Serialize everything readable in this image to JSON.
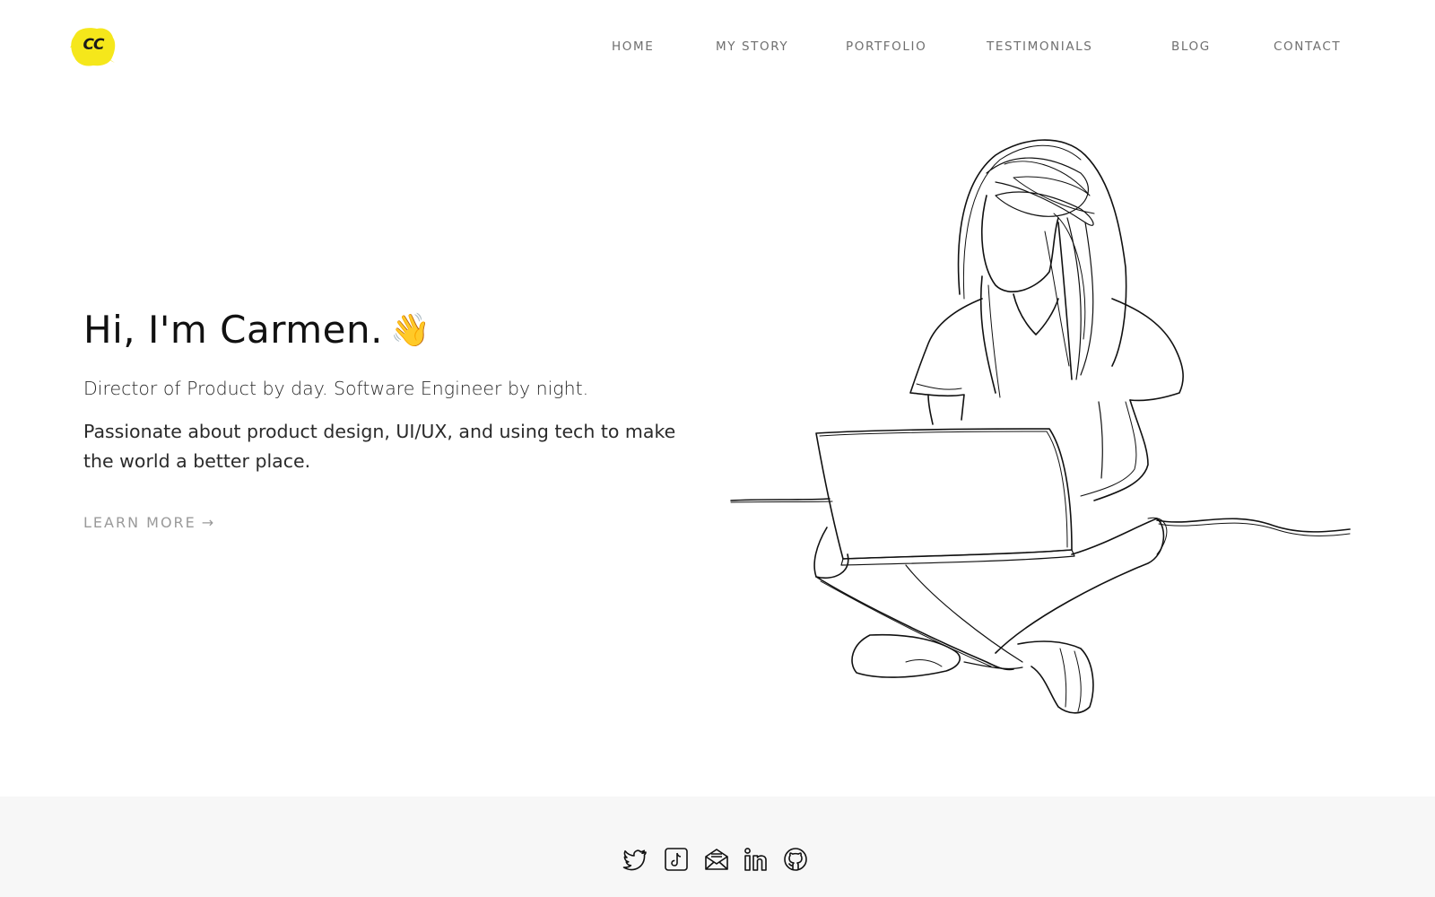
{
  "logo": {
    "text": "CC",
    "color": "#f5e71b"
  },
  "nav": {
    "items": [
      {
        "label": "HOME"
      },
      {
        "label": "MY STORY"
      },
      {
        "label": "PORTFOLIO"
      },
      {
        "label": "TESTIMONIALS"
      },
      {
        "label": "BLOG"
      },
      {
        "label": "CONTACT"
      }
    ]
  },
  "hero": {
    "title": "Hi, I'm Carmen.",
    "title_emoji": "👋",
    "subtitle": "Director of Product by day. Software Engineer by night.",
    "description": "Passionate about product design, UI/UX, and using tech to make the world a better place.",
    "cta_label": "LEARN MORE",
    "cta_arrow": "→"
  },
  "illustration": {
    "subject": "line drawing of woman sitting cross-legged with laptop"
  },
  "footer": {
    "social_icons": [
      "twitter-icon",
      "tiktok-icon",
      "email-icon",
      "linkedin-icon",
      "github-icon"
    ]
  }
}
